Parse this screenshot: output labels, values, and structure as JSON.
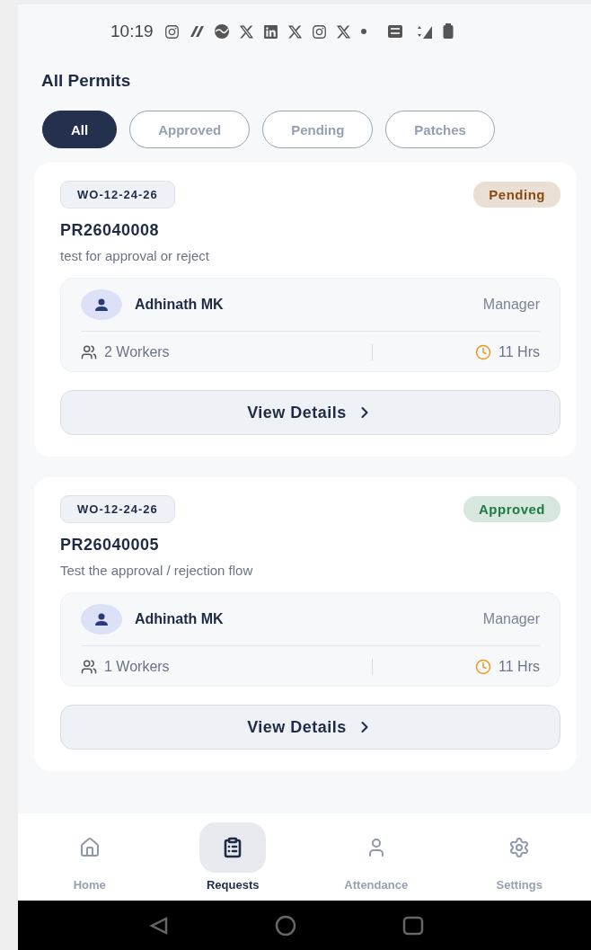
{
  "status_bar": {
    "time": "10:19"
  },
  "title": "All Permits",
  "filters": [
    {
      "label": "All",
      "selected": true
    },
    {
      "label": "Approved",
      "selected": false
    },
    {
      "label": "Pending",
      "selected": false
    },
    {
      "label": "Patches",
      "selected": false
    }
  ],
  "permits": [
    {
      "work_order": "WO-12-24-26",
      "status": "Pending",
      "color": "#8a4b12",
      "id": "PR26040008",
      "description": "test for approval or reject",
      "person": {
        "name": "Adhinath MK",
        "role": "Manager"
      },
      "workers": "2 Workers",
      "duration": "11 Hrs",
      "action": "View Details"
    },
    {
      "work_order": "WO-12-24-26",
      "status": "Approved",
      "color": "#1f7a4a",
      "id": "PR26040005",
      "description": "Test the approval / rejection flow",
      "person": {
        "name": "Adhinath MK",
        "role": "Manager"
      },
      "workers": "1 Workers",
      "duration": "11 Hrs",
      "action": "View Details"
    }
  ],
  "bottom_nav": [
    {
      "label": "Home",
      "selected": false
    },
    {
      "label": "Requests",
      "selected": true
    },
    {
      "label": "Attendance",
      "selected": false
    },
    {
      "label": "Settings",
      "selected": false
    }
  ]
}
